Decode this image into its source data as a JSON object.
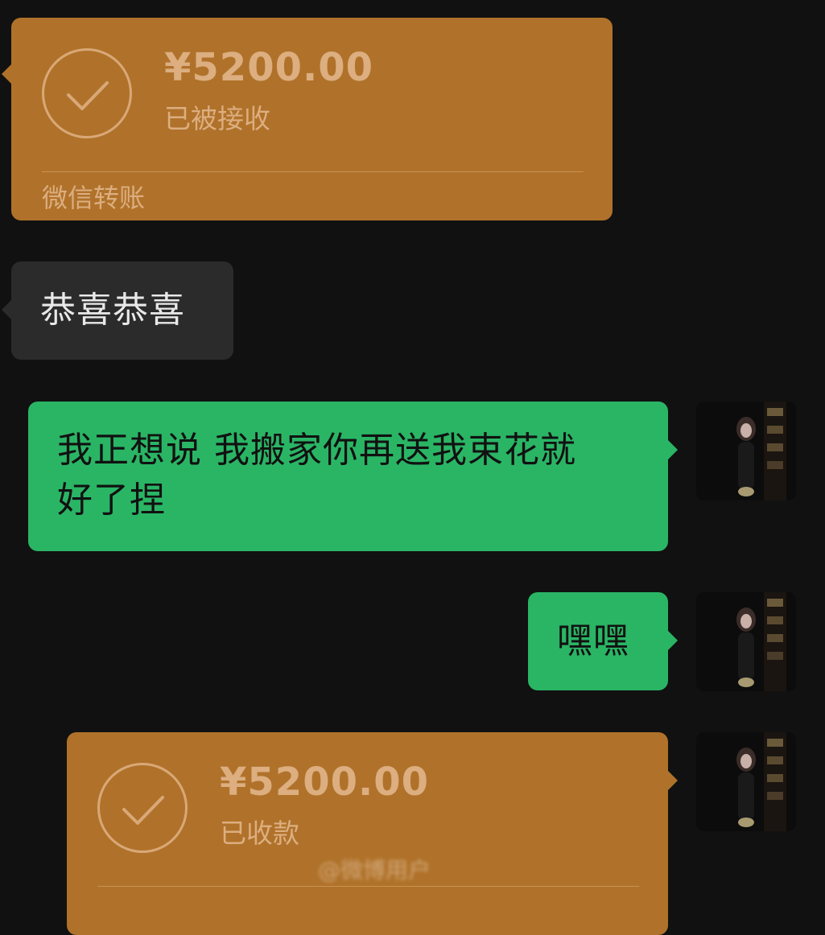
{
  "messages": {
    "transfer_1": {
      "amount": "¥5200.00",
      "status": "已被接收",
      "footer": "微信转账"
    },
    "received_text": "恭喜恭喜",
    "sent_text_1_line1": "我正想说 我搬家你再送我束花就",
    "sent_text_1_line2": "好了捏",
    "sent_text_2": "嘿嘿",
    "transfer_2": {
      "amount": "¥5200.00",
      "status": "已收款"
    }
  },
  "watermark": "@微博用户",
  "colors": {
    "background": "#111111",
    "transfer_card": "#b0722a",
    "transfer_text": "#dcae80",
    "received_bubble": "#2b2b2b",
    "sent_bubble": "#2ab565"
  },
  "icons": {
    "transfer_status": "check-circle-icon"
  }
}
